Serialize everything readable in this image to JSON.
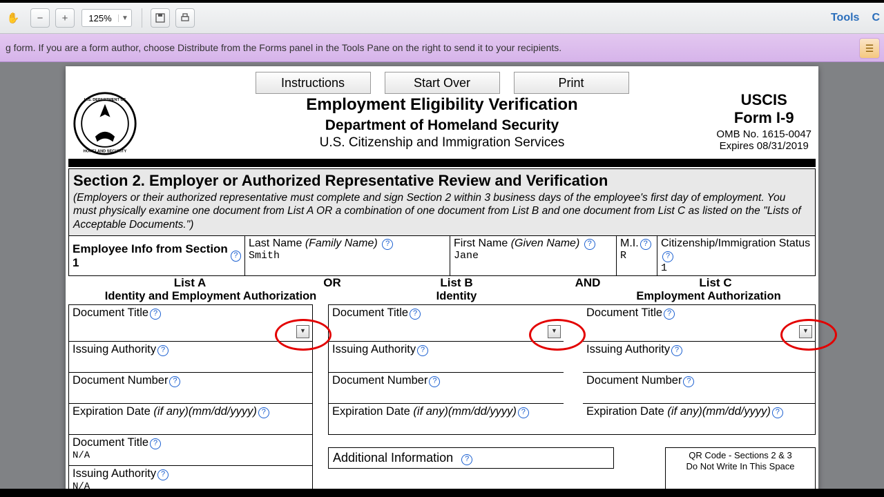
{
  "toolbar": {
    "zoom": "125%",
    "right": {
      "tools": "Tools",
      "other": "C"
    }
  },
  "notice": "g form. If you are a form author, choose Distribute from the Forms panel in the Tools Pane on the right to send it to your recipients.",
  "buttons": {
    "instructions": "Instructions",
    "startover": "Start Over",
    "print": "Print"
  },
  "head": {
    "title": "Employment Eligibility Verification",
    "dept": "Department of Homeland Security",
    "agency": "U.S. Citizenship and Immigration Services",
    "r1": "USCIS",
    "r2": "Form I-9",
    "r3": "OMB No. 1615-0047",
    "r4": "Expires 08/31/2019"
  },
  "sec2": {
    "title": "Section 2. Employer or Authorized Representative Review and Verification",
    "desc": "(Employers or their authorized representative must complete and sign Section 2 within 3 business days of the employee's first day of employment. You must physically examine one document from List A OR a combination of one document from List B and one document from List C as listed on the \"Lists of Acceptable Documents.\")"
  },
  "emp": {
    "label": "Employee Info from Section 1",
    "last_lbl": "Last Name",
    "last_sub": "(Family Name)",
    "last_val": "Smith",
    "first_lbl": "First Name",
    "first_sub": "(Given Name)",
    "first_val": "Jane",
    "mi_lbl": "M.I.",
    "mi_val": "R",
    "cit_lbl": "Citizenship/Immigration Status",
    "cit_val": "1"
  },
  "lists": {
    "a": "List A",
    "a_sub": "Identity and Employment Authorization",
    "b": "List B",
    "b_sub": "Identity",
    "c": "List C",
    "c_sub": "Employment Authorization",
    "or": "OR",
    "and": "AND"
  },
  "labels": {
    "doctitle": "Document Title",
    "issauth": "Issuing Authority",
    "docnum": "Document Number",
    "exp": "Expiration Date ",
    "exp_sub": "(if any)(mm/dd/yyyy)",
    "na": "N/A",
    "addl": "Additional Information",
    "qr1": "QR Code - Sections 2 & 3",
    "qr2": "Do Not Write In This Space"
  }
}
